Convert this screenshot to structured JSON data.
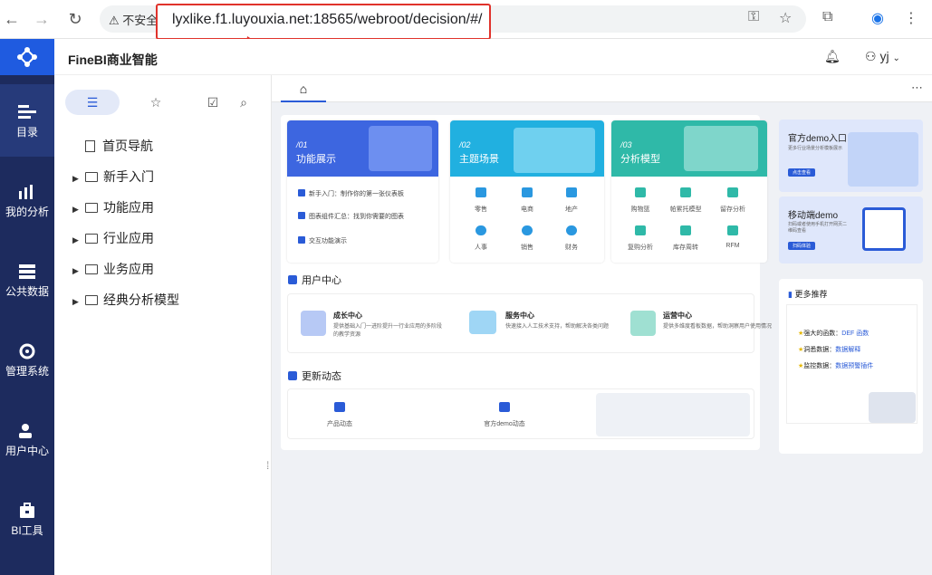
{
  "browser": {
    "warning_label": "不安全",
    "url": "lyxlike.f1.luyouxia.net:18565/webroot/decision/#/"
  },
  "app": {
    "brand": "FineBI商业智能",
    "user": "yj"
  },
  "sidebar": {
    "items": [
      {
        "label": "目录",
        "icon": "catalog-icon"
      },
      {
        "label": "我的分析",
        "icon": "my-analysis-icon"
      },
      {
        "label": "公共数据",
        "icon": "public-data-icon"
      },
      {
        "label": "管理系统",
        "icon": "management-icon"
      },
      {
        "label": "用户中心",
        "icon": "user-center-icon"
      },
      {
        "label": "BI工具",
        "icon": "bi-tool-icon"
      }
    ]
  },
  "panel": {
    "tree": [
      {
        "label": "首页导航"
      },
      {
        "label": "新手入门"
      },
      {
        "label": "功能应用"
      },
      {
        "label": "行业应用"
      },
      {
        "label": "业务应用"
      },
      {
        "label": "经典分析模型"
      }
    ]
  },
  "dashboard": {
    "card1": {
      "num": "/01",
      "title": "功能展示",
      "items": [
        "新手入门：制作你的第一张仪表板",
        "图表组件汇总：找到你需要的图表",
        "交互功能演示"
      ]
    },
    "card2": {
      "num": "/02",
      "title": "主题场景",
      "items": [
        "零售",
        "电商",
        "地产",
        "人事",
        "销售",
        "财务"
      ]
    },
    "card3": {
      "num": "/03",
      "title": "分析模型",
      "items": [
        "购物篮",
        "帕累托模型",
        "留存分析",
        "复购分析",
        "库存周转",
        "RFM"
      ]
    },
    "user_center": {
      "title": "用户中心",
      "items": [
        {
          "title": "成长中心",
          "desc": "提供基础入门一进阶提升一行业应用的多阶段的教学资源"
        },
        {
          "title": "服务中心",
          "desc": "快速接入人工技术支持，帮助解决各类问题"
        },
        {
          "title": "运营中心",
          "desc": "提供多维度看板数据，帮助洞察用户使用情况"
        }
      ]
    },
    "updates": {
      "title": "更新动态",
      "items": [
        "产品动态",
        "官方demo动态"
      ]
    },
    "right": {
      "demo_title": "官方demo入口",
      "demo_desc": "更多行业场景分析模板展示",
      "demo_btn": "点击查看",
      "mobile_title": "移动端demo",
      "mobile_desc": "扫码或者使用手机打开网页二维码查看",
      "mobile_btn": "扫码体验",
      "more_title": "更多推荐",
      "more_items": [
        {
          "prefix": "强大的函数：",
          "link": "DEF 函数"
        },
        {
          "prefix": "洞悉数据：",
          "link": "数据解释"
        },
        {
          "prefix": "监控数据：",
          "link": "数据预警插件"
        }
      ]
    }
  },
  "colors": {
    "sidebar_bg": "#1d2b5e",
    "accent": "#2a5bd7",
    "teal": "#2fb9a8"
  }
}
